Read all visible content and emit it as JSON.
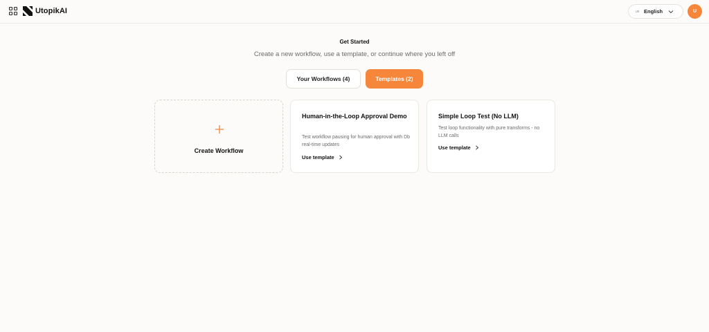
{
  "header": {
    "brand": "UtopikAI",
    "language": {
      "code": "us",
      "label": "English"
    },
    "avatar_initial": "U"
  },
  "intro": {
    "title": "Get Started",
    "subtitle": "Create a new workflow, use a template, or continue where you left off"
  },
  "tabs": [
    {
      "label": "Your Workflows (4)",
      "active": false
    },
    {
      "label": "Templates (2)",
      "active": true
    }
  ],
  "create_card": {
    "label": "Create Workflow"
  },
  "templates": [
    {
      "title": "Human-in-the-Loop Approval Demo",
      "description": "Test workflow pausing for human approval with Db real-time updates",
      "action": "Use template"
    },
    {
      "title": "Simple Loop Test (No LLM)",
      "description": "Test loop functionality with pure transforms - no LLM calls",
      "action": "Use template"
    }
  ],
  "colors": {
    "accent": "#f5863a",
    "background": "#fcfbf9",
    "text": "#111111",
    "muted": "#6b6b6b"
  }
}
